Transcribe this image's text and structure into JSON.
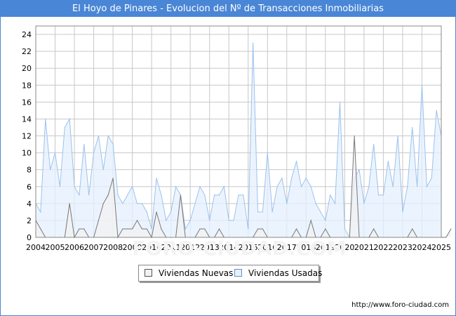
{
  "title": "El Hoyo de Pinares - Evolucion del Nº de Transacciones Inmobiliarias",
  "url_text": "http://www.foro-ciudad.com",
  "watermark": "FORO-CIUDAD.COM",
  "colors": {
    "title_bg": "#4a86d6",
    "nuevas_line": "#777777",
    "nuevas_fill": "#f2f2f2",
    "usadas_line": "#9cc1ee",
    "usadas_fill": "#e4f0fd",
    "grid": "#c8c8c8"
  },
  "chart_data": {
    "type": "area",
    "title": "El Hoyo de Pinares - Evolucion del Nº de Transacciones Inmobiliarias",
    "xlabel": "",
    "ylabel": "",
    "ylim": [
      0,
      25
    ],
    "y_ticks": [
      0,
      2,
      4,
      6,
      8,
      10,
      12,
      14,
      16,
      18,
      20,
      22,
      24
    ],
    "x_tick_labels": [
      "2004",
      "2005",
      "2006",
      "2007",
      "2008",
      "2009",
      "2010",
      "2011",
      "2012",
      "2013",
      "2014",
      "2015",
      "2016",
      "2017",
      "2018",
      "2019",
      "2020",
      "2021",
      "2022",
      "2023",
      "2024",
      "2025"
    ],
    "grid": true,
    "legend_position": "bottom",
    "x_unit": "quarter",
    "series": [
      {
        "name": "Viviendas Nuevas",
        "values": [
          2,
          1,
          0,
          0,
          0,
          0,
          0,
          4,
          0,
          1,
          1,
          0,
          0,
          2,
          4,
          5,
          7,
          0,
          1,
          1,
          1,
          2,
          1,
          1,
          0,
          3,
          1,
          0,
          0,
          0,
          5,
          0,
          0,
          0,
          1,
          1,
          0,
          0,
          1,
          0,
          0,
          0,
          0,
          0,
          0,
          0,
          1,
          1,
          0,
          0,
          0,
          0,
          0,
          0,
          1,
          0,
          0,
          2,
          0,
          0,
          1,
          0,
          0,
          0,
          0,
          0,
          12,
          0,
          0,
          0,
          1,
          0,
          0,
          0,
          0,
          0,
          0,
          0,
          1,
          0,
          0,
          0,
          0,
          0,
          0,
          0,
          1
        ]
      },
      {
        "name": "Viviendas Usadas",
        "values": [
          4,
          3,
          14,
          8,
          10,
          6,
          13,
          14,
          6,
          5,
          11,
          5,
          10,
          12,
          8,
          12,
          11,
          5,
          4,
          5,
          6,
          4,
          4,
          3,
          1,
          7,
          5,
          2,
          3,
          6,
          5,
          1,
          2,
          4,
          6,
          5,
          2,
          5,
          5,
          6,
          2,
          2,
          5,
          5,
          1,
          23,
          3,
          3,
          10,
          3,
          6,
          7,
          4,
          7,
          9,
          6,
          7,
          6,
          4,
          3,
          2,
          5,
          4,
          16,
          1,
          0,
          7,
          8,
          4,
          6,
          11,
          5,
          5,
          9,
          6,
          12,
          3,
          6,
          13,
          6,
          18,
          6,
          7,
          15,
          12
        ]
      }
    ]
  },
  "legend": {
    "items": [
      {
        "label": "Viviendas Nuevas"
      },
      {
        "label": "Viviendas Usadas"
      }
    ]
  }
}
